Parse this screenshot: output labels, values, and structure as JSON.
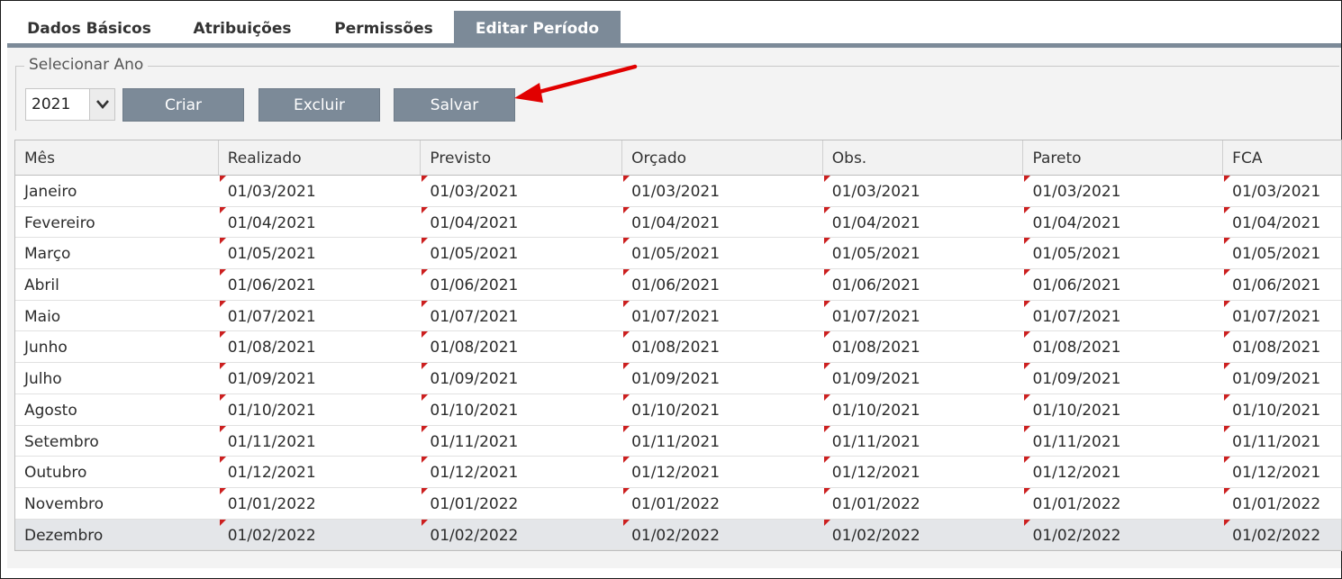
{
  "tabs": [
    "Dados Básicos",
    "Atribuições",
    "Permissões",
    "Editar Período"
  ],
  "active_tab": "Editar Período",
  "fieldset_legend": "Selecionar Ano",
  "year_select": {
    "value": "2021",
    "icon": "chevron-down-icon"
  },
  "buttons": {
    "create": "Criar",
    "delete": "Excluir",
    "save": "Salvar"
  },
  "annotation": {
    "icon": "red-arrow-icon",
    "color": "#e10000"
  },
  "table": {
    "columns": [
      "Mês",
      "Realizado",
      "Previsto",
      "Orçado",
      "Obs.",
      "Pareto",
      "FCA"
    ],
    "rows": [
      [
        "Janeiro",
        "01/03/2021",
        "01/03/2021",
        "01/03/2021",
        "01/03/2021",
        "01/03/2021",
        "01/03/2021"
      ],
      [
        "Fevereiro",
        "01/04/2021",
        "01/04/2021",
        "01/04/2021",
        "01/04/2021",
        "01/04/2021",
        "01/04/2021"
      ],
      [
        "Março",
        "01/05/2021",
        "01/05/2021",
        "01/05/2021",
        "01/05/2021",
        "01/05/2021",
        "01/05/2021"
      ],
      [
        "Abril",
        "01/06/2021",
        "01/06/2021",
        "01/06/2021",
        "01/06/2021",
        "01/06/2021",
        "01/06/2021"
      ],
      [
        "Maio",
        "01/07/2021",
        "01/07/2021",
        "01/07/2021",
        "01/07/2021",
        "01/07/2021",
        "01/07/2021"
      ],
      [
        "Junho",
        "01/08/2021",
        "01/08/2021",
        "01/08/2021",
        "01/08/2021",
        "01/08/2021",
        "01/08/2021"
      ],
      [
        "Julho",
        "01/09/2021",
        "01/09/2021",
        "01/09/2021",
        "01/09/2021",
        "01/09/2021",
        "01/09/2021"
      ],
      [
        "Agosto",
        "01/10/2021",
        "01/10/2021",
        "01/10/2021",
        "01/10/2021",
        "01/10/2021",
        "01/10/2021"
      ],
      [
        "Setembro",
        "01/11/2021",
        "01/11/2021",
        "01/11/2021",
        "01/11/2021",
        "01/11/2021",
        "01/11/2021"
      ],
      [
        "Outubro",
        "01/12/2021",
        "01/12/2021",
        "01/12/2021",
        "01/12/2021",
        "01/12/2021",
        "01/12/2021"
      ],
      [
        "Novembro",
        "01/01/2022",
        "01/01/2022",
        "01/01/2022",
        "01/01/2022",
        "01/01/2022",
        "01/01/2022"
      ],
      [
        "Dezembro",
        "01/02/2022",
        "01/02/2022",
        "01/02/2022",
        "01/02/2022",
        "01/02/2022",
        "01/02/2022"
      ]
    ],
    "selected_row": "Dezembro",
    "dirty_marker_color": "#cc1f1f"
  }
}
